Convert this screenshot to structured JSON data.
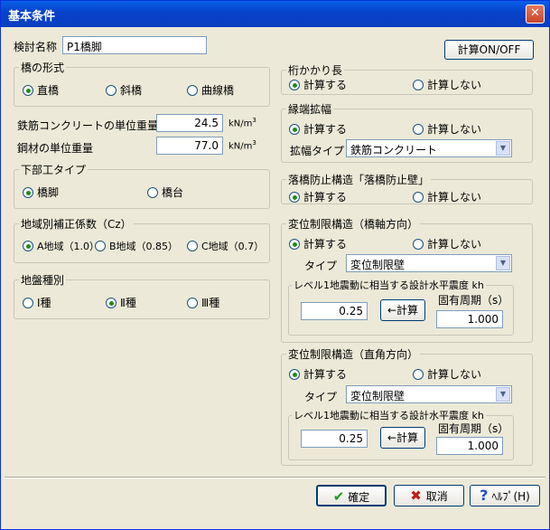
{
  "window": {
    "title": "基本条件",
    "close_icon": "close-icon"
  },
  "left": {
    "name_label": "検討名称",
    "name_value": "P1橋脚",
    "bridge_type": {
      "legend": "橋の形式",
      "opt1": "直橋",
      "opt2": "斜橋",
      "opt3": "曲線橋",
      "selected": "直橋"
    },
    "rebar_label": "鉄筋コンクリートの単位重量",
    "rebar_value": "24.5",
    "rebar_unit": "kN/m",
    "rebar_unit_sup": "3",
    "steel_label": "鋼材の単位重量",
    "steel_value": "77.0",
    "steel_unit": "kN/m",
    "steel_unit_sup": "3",
    "substructure": {
      "legend": "下部工タイプ",
      "opt1": "橋脚",
      "opt2": "橋台",
      "selected": "橋脚"
    },
    "region": {
      "legend": "地域別補正係数（Cz）",
      "opt1": "A地域（1.0）",
      "opt2": "B地域（0.85）",
      "opt3": "C地域（0.7）",
      "selected": "A地域（1.0）"
    },
    "ground": {
      "legend": "地盤種別",
      "opt1": "Ⅰ種",
      "opt2": "Ⅱ種",
      "opt3": "Ⅲ種",
      "selected": "Ⅱ種"
    }
  },
  "right": {
    "calc_onoff_label": "計算ON/OFF",
    "girder": {
      "legend": "桁かかり長",
      "opt1": "計算する",
      "opt2": "計算しない"
    },
    "edge": {
      "legend": "縁端拡幅",
      "opt1": "計算する",
      "opt2": "計算しない",
      "type_label": "拡幅タイプ",
      "type_value": "鉄筋コンクリート"
    },
    "fall": {
      "legend": "落橋防止構造「落橋防止壁」",
      "opt1": "計算する",
      "opt2": "計算しない"
    },
    "disp_axial": {
      "legend": "変位制限構造（橋軸方向）",
      "opt1": "計算する",
      "opt2": "計算しない",
      "type_label": "タイプ",
      "type_value": "変位制限壁",
      "sub_legend": "レベル1地震動に相当する設計水平震度 kh",
      "kh_value": "0.25",
      "calc_label": "←計算",
      "period_label": "固有周期（s）",
      "period_value": "1.000"
    },
    "disp_perp": {
      "legend": "変位制限構造（直角方向）",
      "opt1": "計算する",
      "opt2": "計算しない",
      "type_label": "タイプ",
      "type_value": "変位制限壁",
      "sub_legend": "レベル1地震動に相当する設計水平震度 kh",
      "kh_value": "0.25",
      "calc_label": "←計算",
      "period_label": "固有周期（s）",
      "period_value": "1.000"
    }
  },
  "footer": {
    "ok_label": "確定",
    "cancel_label": "取消",
    "help_label": "ﾍﾙﾌﾟ(H)"
  }
}
